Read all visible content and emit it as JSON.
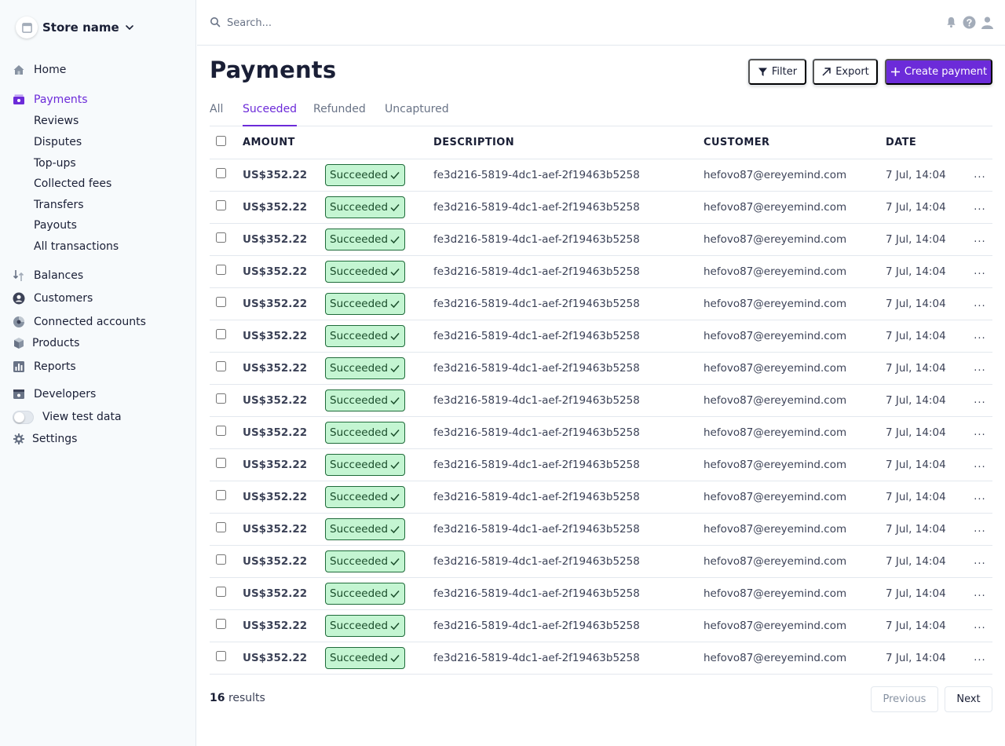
{
  "store": {
    "name": "Store name",
    "logo_icon": "store-icon"
  },
  "nav": {
    "home": "Home",
    "payments": "Payments",
    "payments_sub": [
      "Reviews",
      "Disputes",
      "Top-ups",
      "Collected fees",
      "Transfers",
      "Payouts",
      "All transactions"
    ],
    "balances": "Balances",
    "customers": "Customers",
    "connected_accounts": "Connected accounts",
    "products": "Products",
    "reports": "Reports",
    "developers": "Developers",
    "view_test_data": "View test data",
    "settings": "Settings"
  },
  "search": {
    "placeholder": "Search..."
  },
  "top_icons": [
    "bell-icon",
    "help-icon",
    "user-icon"
  ],
  "page": {
    "title": "Payments"
  },
  "actions": {
    "filter": "Filter",
    "export": "Export",
    "create": "Create payment"
  },
  "tabs": [
    "All",
    "Suceeded",
    "Refunded",
    "Uncaptured"
  ],
  "active_tab": "Suceeded",
  "table": {
    "headers": {
      "amount": "AMOUNT",
      "description": "DESCRIPTION",
      "customer": "CUSTOMER",
      "date": "DATE"
    },
    "rows": [
      {
        "amount": "US$352.22",
        "status": "Succeeded",
        "description": "fe3d216-5819-4dc1-aef-2f19463b5258",
        "customer": "hefovo87@ereyemind.com",
        "date": "7 Jul, 14:04",
        "more": "..."
      },
      {
        "amount": "US$352.22",
        "status": "Succeeded",
        "description": "fe3d216-5819-4dc1-aef-2f19463b5258",
        "customer": "hefovo87@ereyemind.com",
        "date": "7 Jul, 14:04",
        "more": "..."
      },
      {
        "amount": "US$352.22",
        "status": "Succeeded",
        "description": "fe3d216-5819-4dc1-aef-2f19463b5258",
        "customer": "hefovo87@ereyemind.com",
        "date": "7 Jul, 14:04",
        "more": "..."
      },
      {
        "amount": "US$352.22",
        "status": "Succeeded",
        "description": "fe3d216-5819-4dc1-aef-2f19463b5258",
        "customer": "hefovo87@ereyemind.com",
        "date": "7 Jul, 14:04",
        "more": "..."
      },
      {
        "amount": "US$352.22",
        "status": "Succeeded",
        "description": "fe3d216-5819-4dc1-aef-2f19463b5258",
        "customer": "hefovo87@ereyemind.com",
        "date": "7 Jul, 14:04",
        "more": "..."
      },
      {
        "amount": "US$352.22",
        "status": "Succeeded",
        "description": "fe3d216-5819-4dc1-aef-2f19463b5258",
        "customer": "hefovo87@ereyemind.com",
        "date": "7 Jul, 14:04",
        "more": "..."
      },
      {
        "amount": "US$352.22",
        "status": "Succeeded",
        "description": "fe3d216-5819-4dc1-aef-2f19463b5258",
        "customer": "hefovo87@ereyemind.com",
        "date": "7 Jul, 14:04",
        "more": "..."
      },
      {
        "amount": "US$352.22",
        "status": "Succeeded",
        "description": "fe3d216-5819-4dc1-aef-2f19463b5258",
        "customer": "hefovo87@ereyemind.com",
        "date": "7 Jul, 14:04",
        "more": "..."
      },
      {
        "amount": "US$352.22",
        "status": "Succeeded",
        "description": "fe3d216-5819-4dc1-aef-2f19463b5258",
        "customer": "hefovo87@ereyemind.com",
        "date": "7 Jul, 14:04",
        "more": "..."
      },
      {
        "amount": "US$352.22",
        "status": "Succeeded",
        "description": "fe3d216-5819-4dc1-aef-2f19463b5258",
        "customer": "hefovo87@ereyemind.com",
        "date": "7 Jul, 14:04",
        "more": "..."
      },
      {
        "amount": "US$352.22",
        "status": "Succeeded",
        "description": "fe3d216-5819-4dc1-aef-2f19463b5258",
        "customer": "hefovo87@ereyemind.com",
        "date": "7 Jul, 14:04",
        "more": "..."
      },
      {
        "amount": "US$352.22",
        "status": "Succeeded",
        "description": "fe3d216-5819-4dc1-aef-2f19463b5258",
        "customer": "hefovo87@ereyemind.com",
        "date": "7 Jul, 14:04",
        "more": "..."
      },
      {
        "amount": "US$352.22",
        "status": "Succeeded",
        "description": "fe3d216-5819-4dc1-aef-2f19463b5258",
        "customer": "hefovo87@ereyemind.com",
        "date": "7 Jul, 14:04",
        "more": "..."
      },
      {
        "amount": "US$352.22",
        "status": "Succeeded",
        "description": "fe3d216-5819-4dc1-aef-2f19463b5258",
        "customer": "hefovo87@ereyemind.com",
        "date": "7 Jul, 14:04",
        "more": "..."
      },
      {
        "amount": "US$352.22",
        "status": "Succeeded",
        "description": "fe3d216-5819-4dc1-aef-2f19463b5258",
        "customer": "hefovo87@ereyemind.com",
        "date": "7 Jul, 14:04",
        "more": "..."
      },
      {
        "amount": "US$352.22",
        "status": "Succeeded",
        "description": "fe3d216-5819-4dc1-aef-2f19463b5258",
        "customer": "hefovo87@ereyemind.com",
        "date": "7 Jul, 14:04",
        "more": "..."
      }
    ]
  },
  "results": {
    "count": "16",
    "label": "results"
  },
  "pagination": {
    "previous": "Previous",
    "next": "Next"
  },
  "colors": {
    "accent": "#6c2bd9",
    "badge_bg": "#c4f5d2",
    "badge_border": "#1f6b3a",
    "sidebar_bg": "#f7fafc",
    "border": "#e3e8ee"
  }
}
